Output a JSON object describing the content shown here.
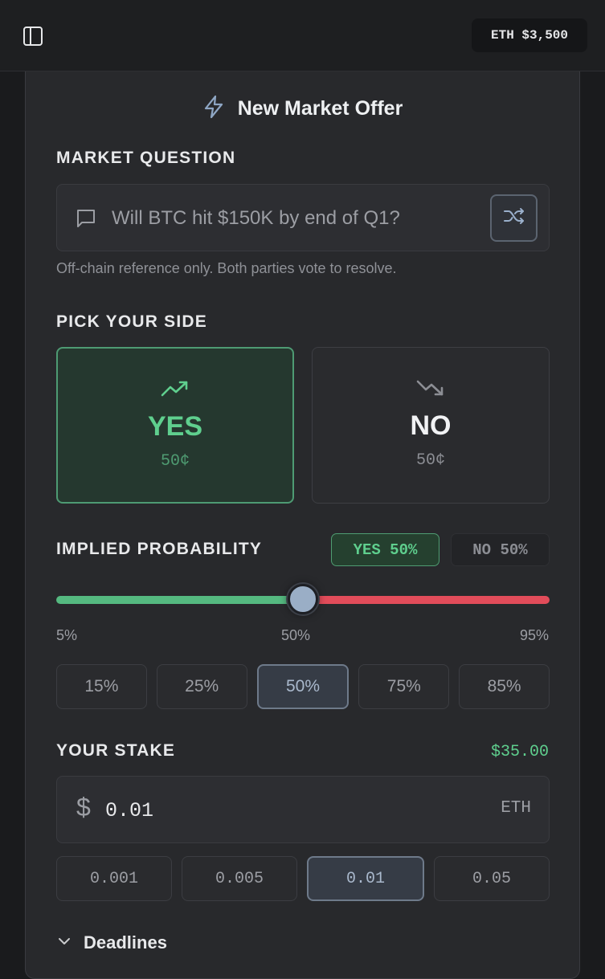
{
  "topbar": {
    "sidebar_icon": "sidebar-toggle-icon",
    "price": "ETH $3,500"
  },
  "form": {
    "title": "New Market Offer",
    "title_icon": "lightning-icon",
    "question": {
      "label": "MARKET QUESTION",
      "placeholder": "Will BTC hit $150K by end of Q1?",
      "value": "",
      "helper": "Off-chain reference only. Both parties vote to resolve.",
      "shuffle_icon": "shuffle-icon"
    },
    "side": {
      "label": "PICK YOUR SIDE",
      "options": [
        {
          "label": "YES",
          "price": "50¢",
          "icon": "trending-up-icon",
          "selected": true
        },
        {
          "label": "NO",
          "price": "50¢",
          "icon": "trending-down-icon",
          "selected": false
        }
      ]
    },
    "probability": {
      "label": "IMPLIED PROBABILITY",
      "yes_badge": "YES 50%",
      "no_badge": "NO 50%",
      "value_percent": 50,
      "min_label": "5%",
      "mid_label": "50%",
      "max_label": "95%",
      "presets": [
        "15%",
        "25%",
        "50%",
        "75%",
        "85%"
      ],
      "active_preset_index": 2
    },
    "stake": {
      "label": "YOUR STAKE",
      "usd_value": "$35.00",
      "currency_sign": "$",
      "value": "0.01",
      "unit": "ETH",
      "presets": [
        "0.001",
        "0.005",
        "0.01",
        "0.05"
      ],
      "active_preset_index": 2
    },
    "deadlines": {
      "label": "Deadlines",
      "collapsed": true
    }
  },
  "colors": {
    "background": "#1a1b1d",
    "card": "#28292c",
    "yes_green": "#5fcf8e",
    "no_red": "#e24c5a",
    "thumb": "#9aaec6"
  }
}
